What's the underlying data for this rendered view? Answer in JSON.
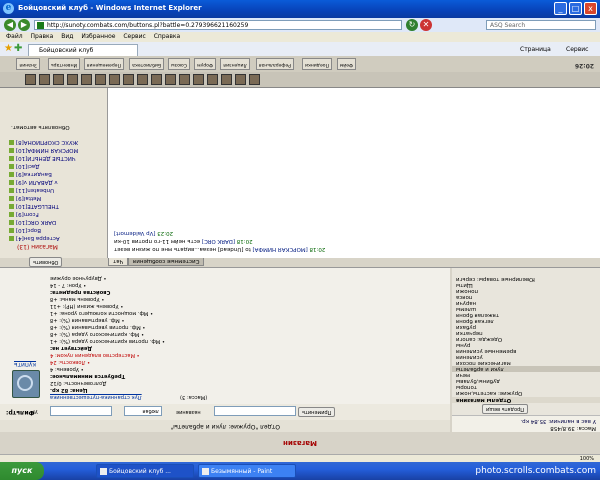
{
  "window": {
    "title": "Бойцовский клуб - Windows Internet Explorer",
    "minimize": "_",
    "maximize": "□",
    "close": "x"
  },
  "address": {
    "url": "http://sunoty.combats.com/buttons.pl?battle=0.279396621160259",
    "search_placeholder": "ASQ Search"
  },
  "menu": [
    "Файл",
    "Правка",
    "Вид",
    "Избранное",
    "Сервис",
    "Справка"
  ],
  "tabbar": {
    "tab_label": "Бойцовский клуб",
    "page_label": "Страница",
    "tools_label": "Сервис"
  },
  "shop": {
    "title": "Магазин",
    "department": "Отдел \"Оружие: луки и арбалеты\"",
    "mass_label": "Масса: 39.8/458",
    "money_label": "У вас в наличии: 35.84 кр.",
    "filter_label": "Фильтр:",
    "filter_input": "",
    "filter_from": "ур.",
    "filter_to": "любая",
    "filter_name": "название",
    "apply_button": "Применить",
    "sell_button": "Продать вещи",
    "category_header": "Отделы магазина",
    "categories": [
      "Оружие: кастеты,ножи",
      "топоры",
      "дубины,булавы",
      "мечи",
      "луки и арбалеты",
      "магические посохи",
      "усиления",
      "временные усиления",
      "руны",
      "Одежда: сапоги",
      "перчатки",
      "рубахи",
      "легкая броня",
      "тяжелая броня",
      "шлемы",
      "наручи",
      "пояса",
      "поножи",
      "Щиты",
      "Ювелирные товары: серьги"
    ],
    "item": {
      "buy_link": "купить",
      "name_link": "Лук странника-путешественника",
      "mass": "(Масса: 3)",
      "price": "Цена: 82 кр.",
      "durability": "Долговечность: 0/12",
      "required_head": "Требуется минимальное:",
      "req_level": "• Уровень: 4",
      "req_agility": "• Ловкость: 24",
      "req_mastery": "• Мастерство владения луком: 4",
      "acts_head": "Действует на:",
      "act_1": "• Мф. против критического удара (%): +1",
      "act_2": "• Мф. критического удара (%): +8",
      "act_3": "• Мф. против увертывания (%): +8",
      "act_4": "• Мф. увертывания (%): +8",
      "act_5": "• Мф. мощности колющего урона: +1",
      "act_6": "• Уровень жизни (HP): +11",
      "act_7": "• Уровень маны: +8",
      "props_head": "Свойства предмета:",
      "prop_1": "• Урон: 7 - 14",
      "prop_2": "• Двуручное оружие"
    }
  },
  "chat": {
    "tab_chat": "Чат",
    "tab_system": "Системные сообщения",
    "messages": [
      {
        "time": "20:18",
        "nick": "[МОРСКАЯ НИМФА]",
        "text": "to [Undead] незаа...видать мне по жизни везет"
      },
      {
        "time": "20:18",
        "nick": "[DARK ORC]",
        "text": "есть нейм 11-го против 10-ки"
      },
      {
        "time": "20:23",
        "nick": "[Vp Valdemort]",
        "text": ""
      }
    ]
  },
  "online": {
    "refresh_button": "Обновить",
    "auto_label": "Обновлять автомат.",
    "location": "Магазин (13)",
    "players": [
      "Астерра Бэн[4]",
      "Ворс[10]",
      "DARK ORC[10]",
      "Fcom[9]",
      "THELLGATE[10]",
      "Mettal[9]",
      "Unbeaten[11]",
      "v ДАВАЛИ v[9]",
      "Бандитка[9]",
      "Дасi[10]",
      "ЧИСТЫЕ ДЕНЬГИ[10]",
      "МОРСКАЯ НИМФА[10]",
      "ЖУХС СКОРПИОНА[8]"
    ]
  },
  "bottom_tabs": [
    "Знания",
    "Инвентарь",
    "Перемещения",
    "Библиотека",
    "Союзы",
    "Форум",
    "Лицензия",
    "Реферальная",
    "Поединки",
    "Фейм"
  ],
  "time_label": "20:26",
  "status": {
    "zoom": "100%"
  },
  "taskbar": {
    "start": "пуск",
    "tasks": [
      "Бойцовский клуб ...",
      "Безымянный - Paint"
    ],
    "watermark": "photo.scrolls.combats.com"
  }
}
